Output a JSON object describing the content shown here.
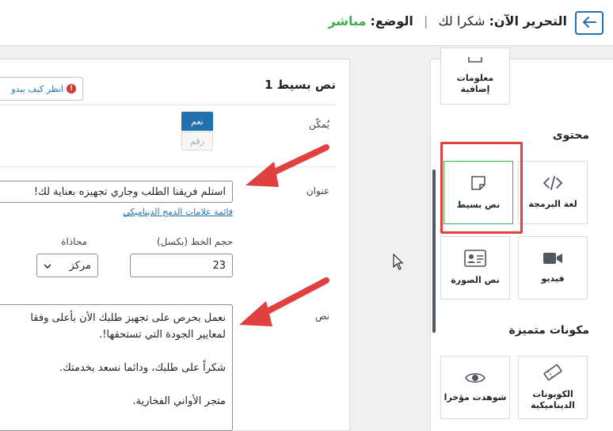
{
  "header": {
    "back_icon": "arrow-left-icon",
    "editing_label": "التحرير الآن:",
    "editing_value": "شكرا لك",
    "mode_label": "الوضع:",
    "mode_value": "مباشر",
    "accent_color": "#2271b1",
    "live_color": "#3fae49"
  },
  "sidebar": {
    "items_top": [
      {
        "label": "معلومات إضافية",
        "icon": "info-file-icon"
      }
    ],
    "content_section": "محتوى",
    "content_items": [
      {
        "label": "لغة البرمجة",
        "icon": "code-icon"
      },
      {
        "label": "نص بسيط",
        "icon": "note-icon"
      },
      {
        "label": "فيديو",
        "icon": "video-camera-icon"
      },
      {
        "label": "نص الصورة",
        "icon": "id-card-icon"
      }
    ],
    "featured_section": "مكونات متميزة",
    "featured_items": [
      {
        "label": "الكوبونات الديناميكية",
        "icon": "ticket-icon"
      },
      {
        "label": "شوهدت مؤخرا",
        "icon": "eye-icon"
      }
    ]
  },
  "panel": {
    "title": "نص بسيط 1",
    "howto_label": "انظر كيف يبدو",
    "enable_label": "يُمكّن",
    "toggle_yes": "نعم",
    "toggle_no": "رقم",
    "heading_label": "عنوان",
    "heading_value": "استلم فريقنا الطلب وجاري تجهيزه بعناية لك!",
    "merge_tags_link": "قائمة علامات الدمج الديناميكي",
    "font_size_label": "حجم الخط (بكسل)",
    "font_size_value": "23",
    "align_label": "محاذاة",
    "align_value": "مركز",
    "text_label": "نص",
    "text_lines": [
      "نعمل بحرص على تجهيز طلبك الأن بأعلى وفقا",
      "لمعايير الجودة التي تستحقها!.",
      "شكراً على طلبك، ودائما نسعد بخدمتك.",
      "متجر الأواني الفخارية."
    ]
  }
}
